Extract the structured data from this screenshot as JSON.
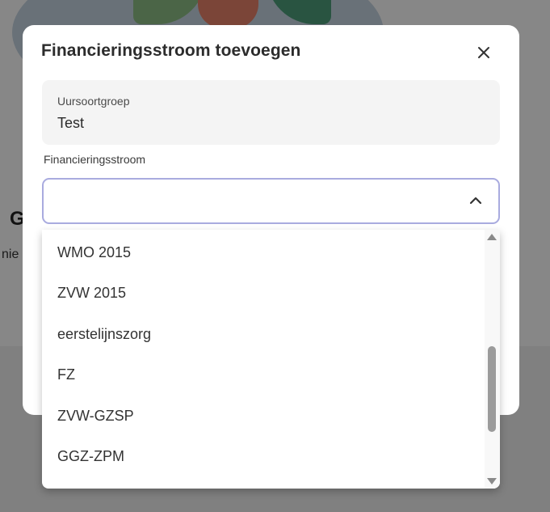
{
  "background": {
    "heading_partial": "G",
    "text_partial": "nie"
  },
  "modal": {
    "title": "Financieringsstroom toevoegen",
    "readonly_field": {
      "label": "Uursoortgroep",
      "value": "Test"
    },
    "select": {
      "label": "Financieringsstroom",
      "value": "",
      "state": "open"
    }
  },
  "dropdown": {
    "options": [
      "WMO 2015",
      "ZVW 2015",
      "eerstelijnszorg",
      "FZ",
      "ZVW-GZSP",
      "GGZ-ZPM"
    ]
  },
  "icons": {
    "close": "close-icon",
    "chevron": "chevron-up-icon",
    "scroll_up": "scroll-up-arrow-icon",
    "scroll_down": "scroll-down-arrow-icon"
  },
  "colors": {
    "select_border": "#a9abdf",
    "overlay": "rgba(0,0,0,0.47)"
  }
}
